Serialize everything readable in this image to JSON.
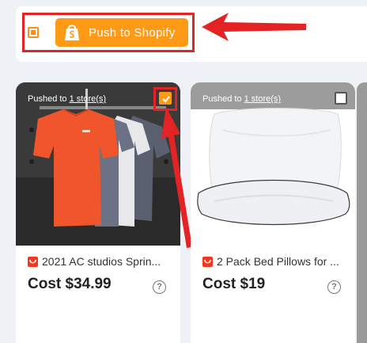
{
  "toolbar": {
    "push_label": "Push to Shopify",
    "select_all_state": "partial",
    "accent_color": "#ff9a17"
  },
  "annotations": {
    "highlight_color": "#e42424"
  },
  "products": [
    {
      "pushed_prefix": "Pushed to ",
      "pushed_link": "1 store(s)",
      "title": "2021 AC studios Sprin...",
      "cost": "Cost $34.99",
      "checked": true,
      "source_icon": "aliexpress-icon"
    },
    {
      "pushed_prefix": "Pushed to ",
      "pushed_link": "1 store(s)",
      "title": "2 Pack Bed Pillows for ...",
      "cost": "Cost $19",
      "checked": false,
      "source_icon": "aliexpress-icon"
    }
  ],
  "help_glyph": "?"
}
